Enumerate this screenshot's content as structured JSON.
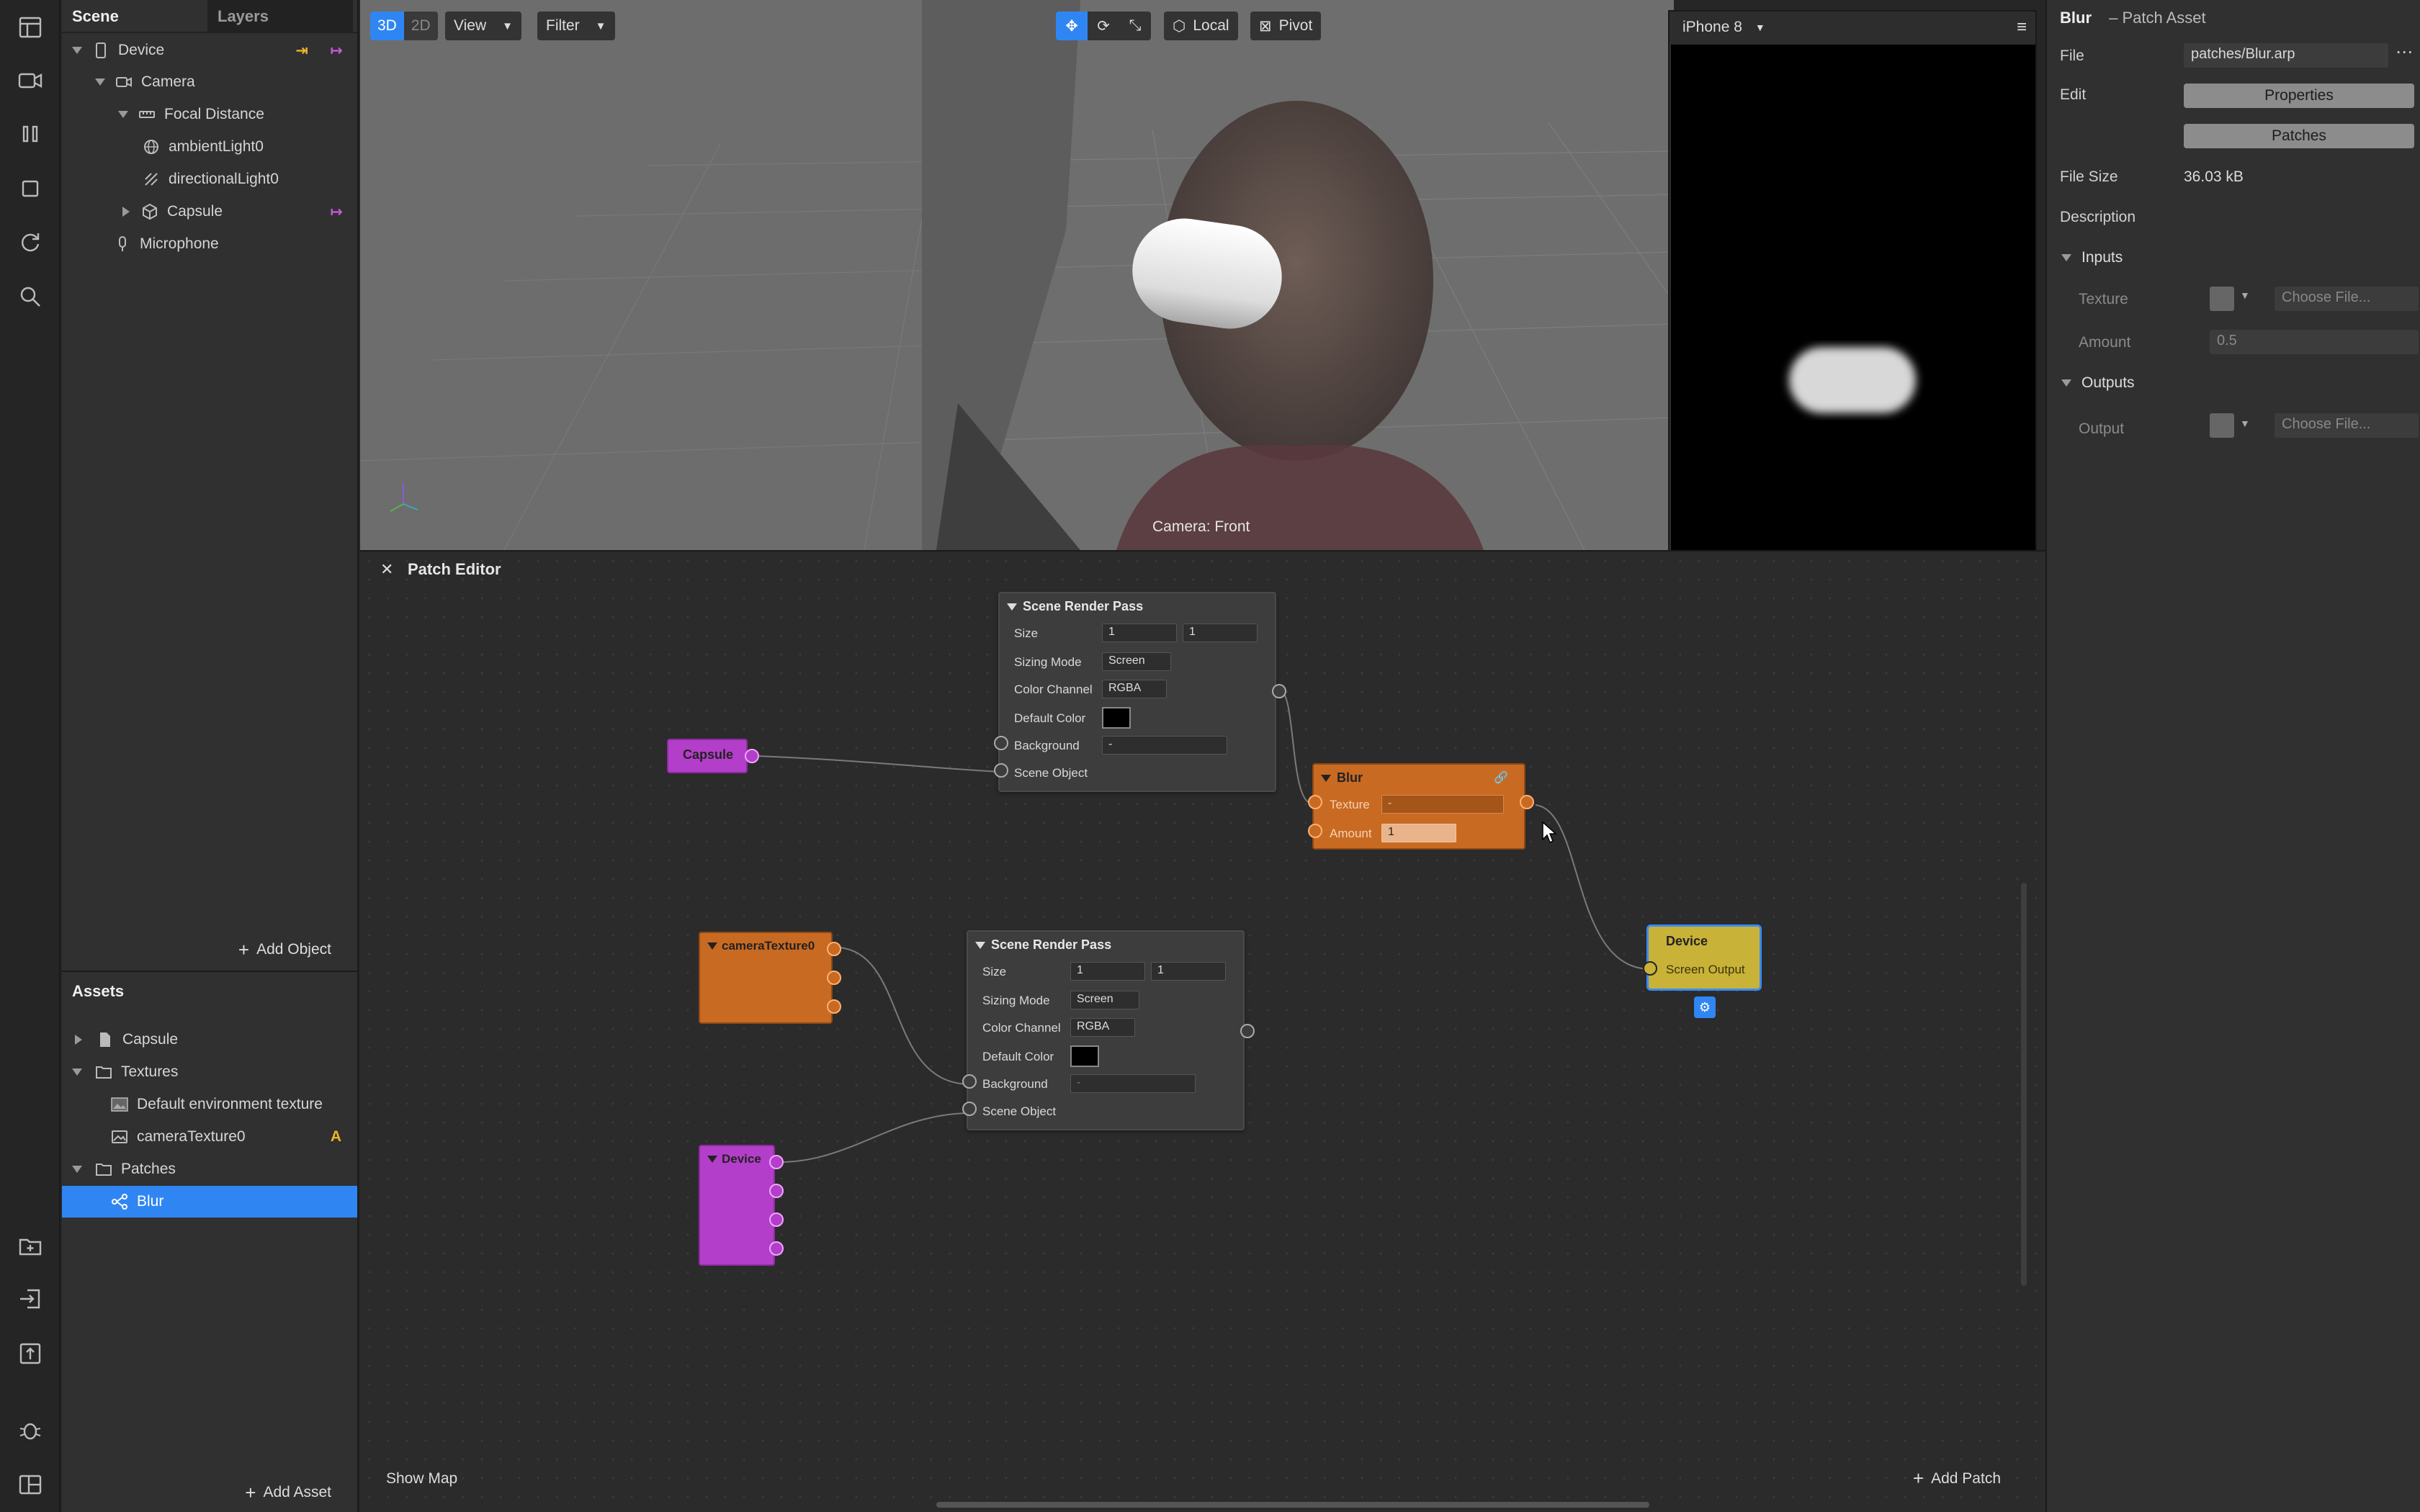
{
  "scene_panel": {
    "tabs": [
      "Scene",
      "Layers"
    ],
    "tree": [
      {
        "label": "Device",
        "icon": "phone-icon"
      },
      {
        "label": "Camera",
        "icon": "camera-icon"
      },
      {
        "label": "Focal Distance",
        "icon": "ruler-icon"
      },
      {
        "label": "ambientLight0",
        "icon": "globe-icon"
      },
      {
        "label": "directionalLight0",
        "icon": "directional-light-icon"
      },
      {
        "label": "Capsule",
        "icon": "cube-icon"
      },
      {
        "label": "Microphone",
        "icon": "microphone-icon"
      }
    ],
    "add_object": "Add Object"
  },
  "assets_panel": {
    "title": "Assets",
    "items": [
      {
        "label": "Capsule",
        "icon": "file-icon"
      },
      {
        "label": "Textures",
        "icon": "folder-icon"
      },
      {
        "label": "Default environment texture",
        "icon": "image-icon"
      },
      {
        "label": "cameraTexture0",
        "icon": "image-icon",
        "badge": "A"
      },
      {
        "label": "Patches",
        "icon": "folder-icon"
      },
      {
        "label": "Blur",
        "icon": "patch-icon"
      }
    ],
    "add_asset": "Add Asset"
  },
  "viewport": {
    "mode_3d": "3D",
    "mode_2d": "2D",
    "view": "View",
    "filter": "Filter",
    "local": "Local",
    "pivot": "Pivot",
    "camera_label": "Camera: Front"
  },
  "simulator": {
    "device": "iPhone 8"
  },
  "inspector": {
    "title": "Blur",
    "subtitle": "– Patch Asset",
    "file_label": "File",
    "file_value": "patches/Blur.arp",
    "edit_label": "Edit",
    "properties_btn": "Properties",
    "patches_btn": "Patches",
    "file_size_label": "File Size",
    "file_size_value": "36.03 kB",
    "description_label": "Description",
    "inputs_label": "Inputs",
    "texture_label": "Texture",
    "choose_file": "Choose File...",
    "amount_label": "Amount",
    "amount_value": "0.5",
    "outputs_label": "Outputs",
    "output_label": "Output"
  },
  "patch_editor": {
    "title": "Patch Editor",
    "show_map": "Show Map",
    "add_patch": "Add Patch",
    "render_pass_1": {
      "title": "Scene Render Pass",
      "size": "Size",
      "size_x": "1",
      "size_y": "1",
      "sizing_mode": "Sizing Mode",
      "sizing_value": "Screen",
      "color_channel": "Color Channel",
      "color_value": "RGBA",
      "default_color": "Default Color",
      "background": "Background",
      "background_value": "-",
      "scene_object": "Scene Object"
    },
    "render_pass_2": {
      "title": "Scene Render Pass",
      "size": "Size",
      "size_x": "1",
      "size_y": "1",
      "sizing_mode": "Sizing Mode",
      "sizing_value": "Screen",
      "color_channel": "Color Channel",
      "color_value": "RGBA",
      "default_color": "Default Color",
      "background": "Background",
      "background_value": "-",
      "scene_object": "Scene Object"
    },
    "capsule_node": "Capsule",
    "blur_node": {
      "title": "Blur",
      "texture": "Texture",
      "texture_value": "-",
      "amount": "Amount",
      "amount_value": "1"
    },
    "camera_texture_node": "cameraTexture0",
    "device_node": "Device",
    "device_output": {
      "title": "Device",
      "port": "Screen Output"
    }
  },
  "colors": {
    "accent": "#2f86f3",
    "patch_orange": "#c96a22",
    "patch_purple": "#b33ec9",
    "patch_yellow": "#c8b237"
  }
}
